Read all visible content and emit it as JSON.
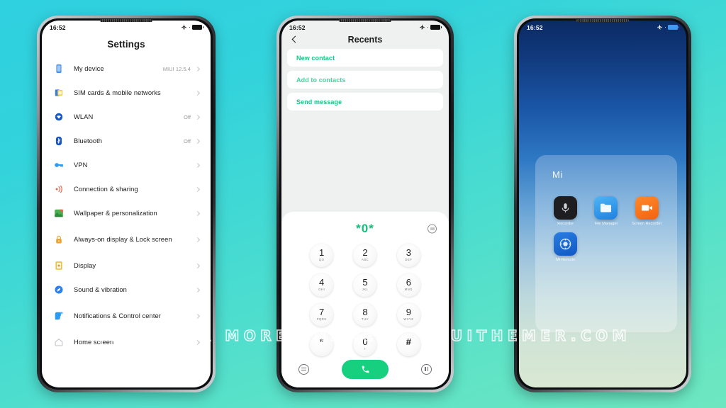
{
  "background": {
    "color_top": "#2fd0e0",
    "color_bottom": "#6ee7bf"
  },
  "watermark": {
    "text": "VISIT FOR MORE THEMES - MIUITHEMER.COM"
  },
  "phone_settings": {
    "status_bar": {
      "time": "16:52",
      "airplane_icon": "airplane-mode-icon",
      "battery_icon": "battery-icon"
    },
    "title": "Settings",
    "items": [
      {
        "label": "My device",
        "value": "MIUI 12.5.4",
        "icon": "phone-icon",
        "color": "#2d7ff0"
      },
      {
        "label": "SIM cards & mobile networks",
        "value": "",
        "icon": "sim-card-icon",
        "color": "#f0c02d"
      },
      {
        "label": "WLAN",
        "value": "Off",
        "icon": "wifi-icon",
        "color": "#1758c4"
      },
      {
        "label": "Bluetooth",
        "value": "Off",
        "icon": "bluetooth-icon",
        "color": "#1758c4"
      },
      {
        "label": "VPN",
        "value": "",
        "icon": "key-icon",
        "color": "#2d9bf0"
      },
      {
        "label": "Connection & sharing",
        "value": "",
        "icon": "broadcast-icon",
        "color": "#e8644f"
      },
      {
        "label": "Wallpaper & personalization",
        "value": "",
        "icon": "image-icon",
        "color": "#4caf50"
      },
      {
        "label": "Always-on display & Lock screen",
        "value": "",
        "icon": "lock-icon",
        "color": "#f0a22d"
      },
      {
        "label": "Display",
        "value": "",
        "icon": "brightness-icon",
        "color": "#e8c44f"
      },
      {
        "label": "Sound & vibration",
        "value": "",
        "icon": "sound-icon",
        "color": "#2d7ff0"
      },
      {
        "label": "Notifications & Control center",
        "value": "",
        "icon": "notification-icon",
        "color": "#2d9bf0"
      },
      {
        "label": "Home screen",
        "value": "",
        "icon": "home-icon",
        "color": "#c8cdd2"
      }
    ]
  },
  "phone_dialer": {
    "status_bar": {
      "time": "16:52"
    },
    "header": {
      "title": "Recents",
      "back_icon": "back-chevron-icon"
    },
    "actions": [
      {
        "label": "New contact"
      },
      {
        "label": "Add to contacts"
      },
      {
        "label": "Send message"
      }
    ],
    "display": {
      "number": "*0*",
      "options_icon": "options-circle-icon"
    },
    "keys": [
      {
        "digit": "1",
        "letters": "QO"
      },
      {
        "digit": "2",
        "letters": "ABC"
      },
      {
        "digit": "3",
        "letters": "DEF"
      },
      {
        "digit": "4",
        "letters": "GHI"
      },
      {
        "digit": "5",
        "letters": "JKL"
      },
      {
        "digit": "6",
        "letters": "MNO"
      },
      {
        "digit": "7",
        "letters": "PQRS"
      },
      {
        "digit": "8",
        "letters": "TUV"
      },
      {
        "digit": "9",
        "letters": "WXYZ"
      },
      {
        "digit": "*",
        "letters": ""
      },
      {
        "digit": "0",
        "letters": "+"
      },
      {
        "digit": "#",
        "letters": ""
      }
    ],
    "bottom": {
      "left_icon": "menu-circle-icon",
      "call_icon": "call-icon",
      "right_icon": "pause-circle-icon",
      "call_color": "#16cf7f"
    }
  },
  "phone_home": {
    "status_bar": {
      "time": "16:52"
    },
    "widget": {
      "title": "Mi",
      "apps": [
        {
          "name": "Recorder",
          "icon": "microphone-icon"
        },
        {
          "name": "File Manager",
          "icon": "folder-icon"
        },
        {
          "name": "Screen Recorder",
          "icon": "video-camera-icon"
        },
        {
          "name": "Mi Remote",
          "icon": "remote-control-icon"
        }
      ]
    }
  }
}
